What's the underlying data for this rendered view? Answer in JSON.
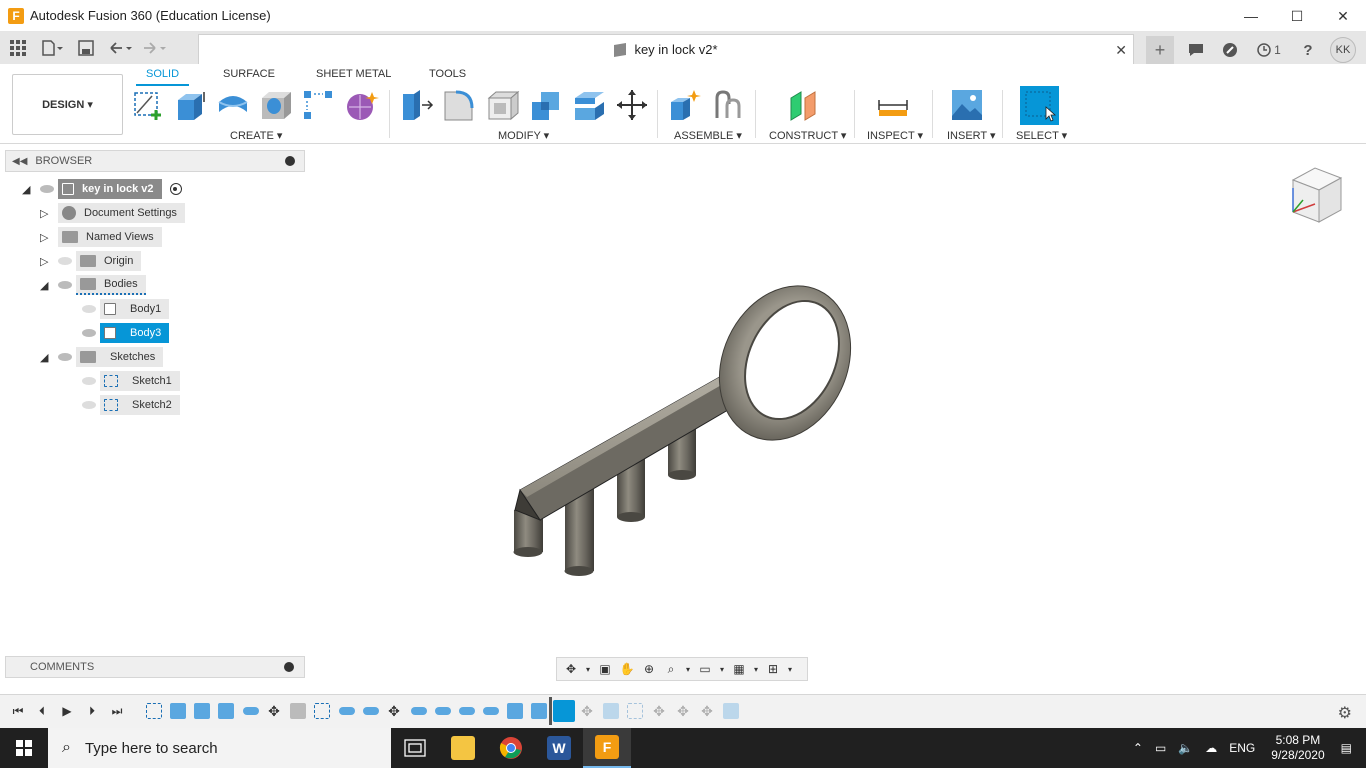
{
  "window": {
    "title": "Autodesk Fusion 360 (Education License)",
    "minimize": "—",
    "maximize": "☐",
    "close": "✕"
  },
  "tabbar": {
    "doc_title": "key in lock v2*",
    "close": "✕",
    "new_tab": "+",
    "jobs_count": "1",
    "help": "?",
    "user_initials": "KK"
  },
  "ribbon": {
    "workspace": "DESIGN ▾",
    "tabs": [
      {
        "label": "SOLID",
        "active": true
      },
      {
        "label": "SURFACE"
      },
      {
        "label": "SHEET METAL"
      },
      {
        "label": "TOOLS"
      }
    ],
    "groups": {
      "create": "CREATE ▾",
      "modify": "MODIFY ▾",
      "assemble": "ASSEMBLE ▾",
      "construct": "CONSTRUCT ▾",
      "inspect": "INSPECT ▾",
      "insert": "INSERT ▾",
      "select": "SELECT ▾"
    }
  },
  "browser": {
    "header": "BROWSER",
    "root": "key in lock v2",
    "items": {
      "document_settings": "Document Settings",
      "named_views": "Named Views",
      "origin": "Origin",
      "bodies": "Bodies",
      "body1": "Body1",
      "body3": "Body3",
      "sketches": "Sketches",
      "sketch1": "Sketch1",
      "sketch2": "Sketch2"
    }
  },
  "comments": {
    "header": "COMMENTS"
  },
  "taskbar": {
    "search_placeholder": "Type here to search",
    "language": "ENG",
    "time": "5:08 PM",
    "date": "9/28/2020"
  },
  "colors": {
    "accent": "#0696d7",
    "taskbar": "#202020",
    "selected_item": "#0696d7"
  }
}
